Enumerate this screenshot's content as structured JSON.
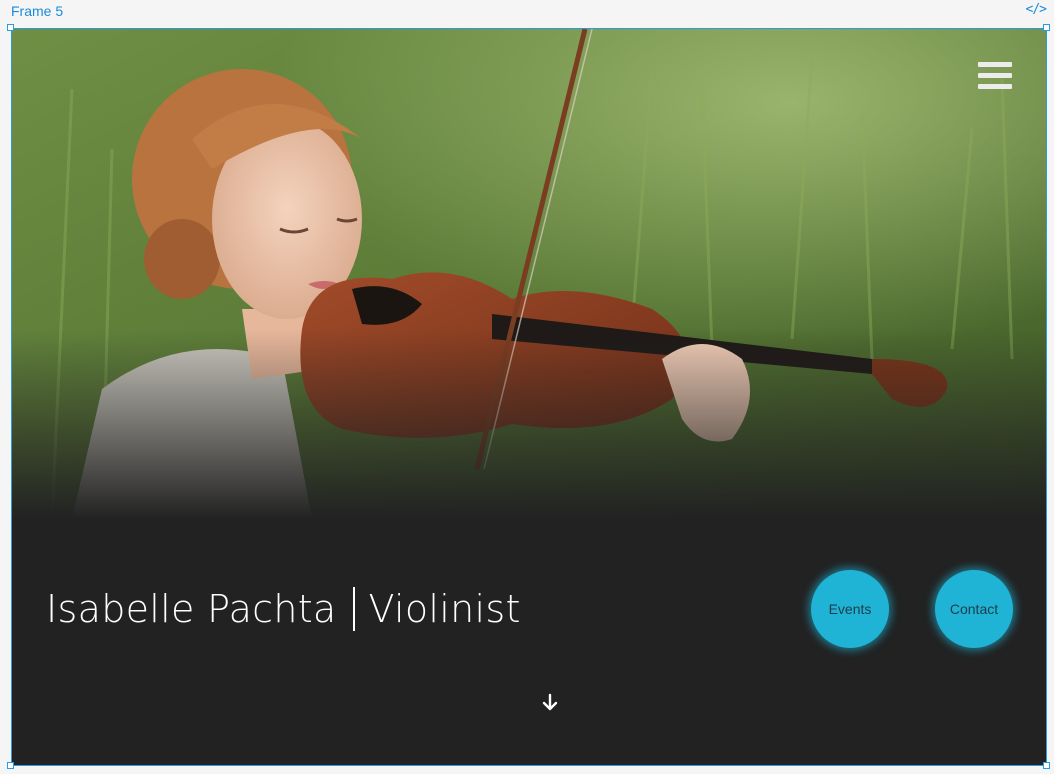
{
  "editor": {
    "frame_label": "Frame 5",
    "code_toggle_label": "</>"
  },
  "hero": {
    "name": "Isabelle Pachta",
    "role": "Violinist"
  },
  "buttons": {
    "events": "Events",
    "contact": "Contact"
  },
  "icons": {
    "menu": "hamburger-menu-icon",
    "scroll": "arrow-down-icon"
  },
  "colors": {
    "accent": "#1fb3d6",
    "background": "#222222",
    "selection": "#2a9be0"
  }
}
